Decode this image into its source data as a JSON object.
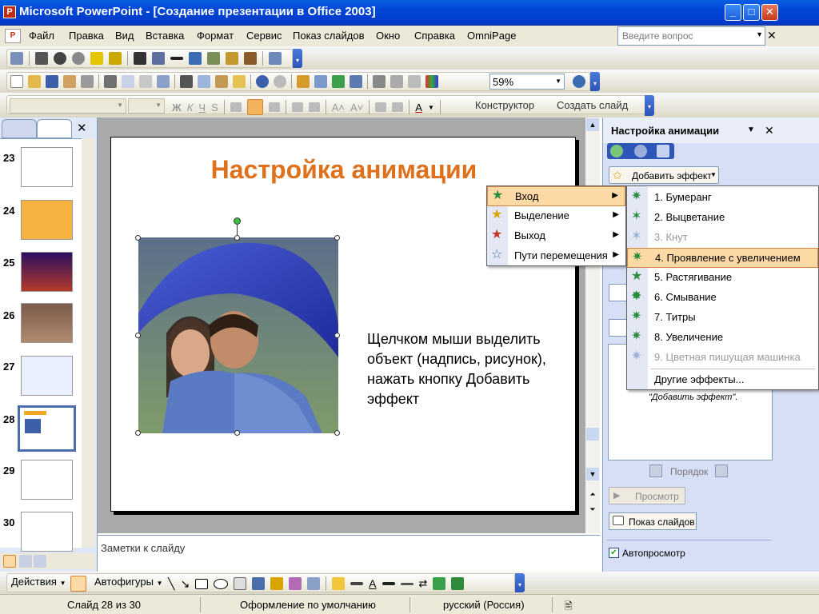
{
  "window": {
    "title": "Microsoft PowerPoint - [Создание презентации в Office 2003]"
  },
  "menubar": {
    "items": [
      "Файл",
      "Правка",
      "Вид",
      "Вставка",
      "Формат",
      "Сервис",
      "Показ слайдов",
      "Окно",
      "Справка",
      "OmniPage"
    ],
    "help_placeholder": "Введите вопрос"
  },
  "toolbar": {
    "zoom": "59%",
    "constructor_label": "Конструктор",
    "create_slide_label": "Создать слайд"
  },
  "thumbnails": [
    {
      "num": "23",
      "color": "#f4f4ff"
    },
    {
      "num": "24",
      "color": "#f6b340"
    },
    {
      "num": "25",
      "color": "#4a2080"
    },
    {
      "num": "26",
      "color": "#8a6a5a"
    },
    {
      "num": "27",
      "color": "#eaf0ff"
    },
    {
      "num": "28",
      "color": "#ffffff"
    },
    {
      "num": "29",
      "color": "#ffffff"
    },
    {
      "num": "30",
      "color": "#ffffff"
    }
  ],
  "slide": {
    "title": "Настройка анимации",
    "body": "Щелчком мыши выделить объект (надпись, рисунок), нажать кнопку Добавить эффект"
  },
  "notes": {
    "placeholder": "Заметки к слайду"
  },
  "taskpane": {
    "title": "Настройка анимации",
    "add_effect": "Добавить эффект",
    "hint": "\"Добавить эффект\".",
    "order_label": "Порядок",
    "preview_label": "Просмотр",
    "slideshow_label": "Показ слайдов",
    "autopreview_label": "Автопросмотр"
  },
  "effect_menu": [
    {
      "label": "Вход",
      "hot": true
    },
    {
      "label": "Выделение",
      "hot": false
    },
    {
      "label": "Выход",
      "hot": false
    },
    {
      "label": "Пути перемещения",
      "hot": false
    }
  ],
  "entrance_menu": [
    {
      "label": "1. Бумеранг",
      "enabled": true,
      "hot": false
    },
    {
      "label": "2. Выцветание",
      "enabled": true,
      "hot": false
    },
    {
      "label": "3. Кнут",
      "enabled": false,
      "hot": false
    },
    {
      "label": "4. Проявление с увеличением",
      "enabled": true,
      "hot": true
    },
    {
      "label": "5. Растягивание",
      "enabled": true,
      "hot": false
    },
    {
      "label": "6. Смывание",
      "enabled": true,
      "hot": false
    },
    {
      "label": "7. Титры",
      "enabled": true,
      "hot": false
    },
    {
      "label": "8. Увеличение",
      "enabled": true,
      "hot": false
    },
    {
      "label": "9. Цветная пишущая машинка",
      "enabled": false,
      "hot": false
    },
    {
      "label": "Другие эффекты...",
      "enabled": true,
      "hot": false
    }
  ],
  "drawbar": {
    "actions_label": "Действия",
    "autoshapes_label": "Автофигуры"
  },
  "status": {
    "slide": "Слайд 28 из 30",
    "design": "Оформление по умолчанию",
    "language": "русский (Россия)"
  }
}
